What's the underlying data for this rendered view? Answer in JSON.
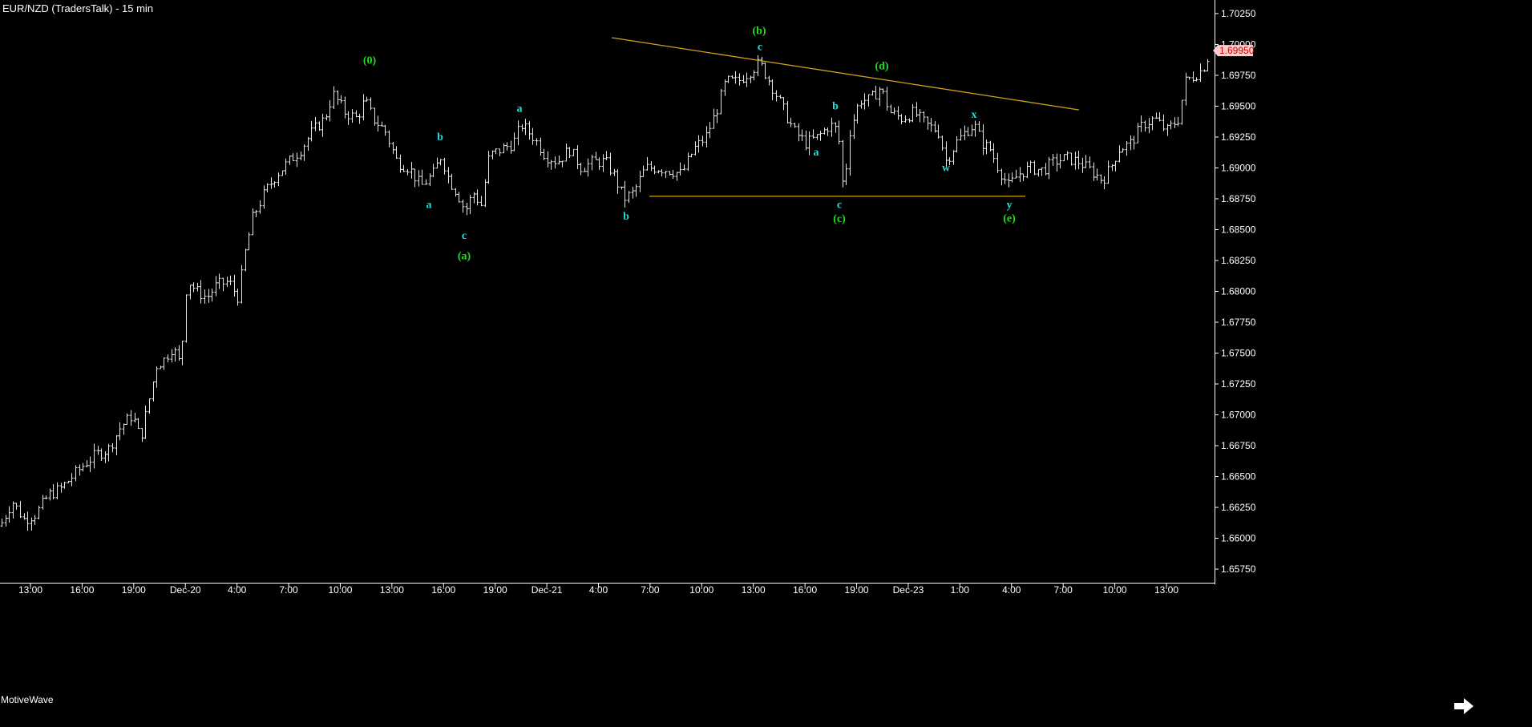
{
  "header": {
    "title": "EUR/NZD (TradersTalk) - 15 min"
  },
  "footer": {
    "brand": "MotiveWave"
  },
  "colors": {
    "background": "#000000",
    "bars": "#e6e6e6",
    "trendline": "#d4a017",
    "wave_major": "#22dd22",
    "wave_minor": "#22dddd",
    "price_badge_bg": "#ffcccc",
    "price_badge_text": "#cc0000"
  },
  "chart_data": {
    "type": "ohlc",
    "instrument": "EUR/NZD",
    "timeframe": "15 min",
    "x_tick_labels": [
      "13:00",
      "16:00",
      "19:00",
      "Dec-20",
      "4:00",
      "7:00",
      "10:00",
      "13:00",
      "16:00",
      "19:00",
      "Dec-21",
      "4:00",
      "7:00",
      "10:00",
      "13:00",
      "16:00",
      "19:00",
      "Dec-23",
      "1:00",
      "4:00",
      "7:00",
      "10:00",
      "13:00"
    ],
    "ylim": [
      1.6564,
      1.7036
    ],
    "y_ticks": [
      1.7025,
      1.7,
      1.6975,
      1.695,
      1.6925,
      1.69,
      1.6875,
      1.685,
      1.6825,
      1.68,
      1.6775,
      1.675,
      1.6725,
      1.67,
      1.6675,
      1.665,
      1.6625,
      1.66,
      1.6575
    ],
    "y_tick_labels": [
      "1.70250",
      "1.70000",
      "1.69750",
      "1.69500",
      "1.69250",
      "1.69000",
      "1.68750",
      "1.68500",
      "1.68250",
      "1.68000",
      "1.67750",
      "1.67500",
      "1.67250",
      "1.67000",
      "1.66750",
      "1.66500",
      "1.66250",
      "1.66000",
      "1.65750"
    ],
    "last_price": "1.69950",
    "price_path": [
      [
        0,
        1.661
      ],
      [
        15,
        1.663
      ],
      [
        30,
        1.6615
      ],
      [
        45,
        1.662
      ],
      [
        60,
        1.6635
      ],
      [
        75,
        1.664
      ],
      [
        90,
        1.665
      ],
      [
        105,
        1.666
      ],
      [
        120,
        1.6668
      ],
      [
        135,
        1.6672
      ],
      [
        150,
        1.669
      ],
      [
        165,
        1.67
      ],
      [
        175,
        1.668
      ],
      [
        185,
        1.671
      ],
      [
        195,
        1.674
      ],
      [
        205,
        1.6745
      ],
      [
        215,
        1.6755
      ],
      [
        225,
        1.674
      ],
      [
        233,
        1.681
      ],
      [
        245,
        1.68
      ],
      [
        258,
        1.6795
      ],
      [
        270,
        1.6805
      ],
      [
        285,
        1.6808
      ],
      [
        297,
        1.6795
      ],
      [
        305,
        1.683
      ],
      [
        315,
        1.686
      ],
      [
        330,
        1.688
      ],
      [
        345,
        1.6895
      ],
      [
        360,
        1.6905
      ],
      [
        375,
        1.6915
      ],
      [
        390,
        1.693
      ],
      [
        405,
        1.694
      ],
      [
        415,
        1.696
      ],
      [
        430,
        1.6945
      ],
      [
        445,
        1.694
      ],
      [
        455,
        1.6955
      ],
      [
        465,
        1.694
      ],
      [
        480,
        1.693
      ],
      [
        495,
        1.6905
      ],
      [
        510,
        1.69
      ],
      [
        525,
        1.6885
      ],
      [
        540,
        1.6895
      ],
      [
        550,
        1.691
      ],
      [
        560,
        1.689
      ],
      [
        570,
        1.688
      ],
      [
        580,
        1.6865
      ],
      [
        590,
        1.688
      ],
      [
        600,
        1.687
      ],
      [
        610,
        1.691
      ],
      [
        625,
        1.6915
      ],
      [
        640,
        1.692
      ],
      [
        650,
        1.6935
      ],
      [
        665,
        1.6925
      ],
      [
        680,
        1.691
      ],
      [
        695,
        1.6905
      ],
      [
        710,
        1.6915
      ],
      [
        725,
        1.69
      ],
      [
        740,
        1.6905
      ],
      [
        755,
        1.6905
      ],
      [
        765,
        1.6895
      ],
      [
        778,
        1.6875
      ],
      [
        790,
        1.688
      ],
      [
        805,
        1.69
      ],
      [
        820,
        1.69
      ],
      [
        835,
        1.6898
      ],
      [
        850,
        1.6895
      ],
      [
        865,
        1.6915
      ],
      [
        880,
        1.6925
      ],
      [
        893,
        1.6945
      ],
      [
        905,
        1.697
      ],
      [
        920,
        1.697
      ],
      [
        935,
        1.6978
      ],
      [
        947,
        1.6985
      ],
      [
        960,
        1.697
      ],
      [
        975,
        1.695
      ],
      [
        990,
        1.693
      ],
      [
        1005,
        1.692
      ],
      [
        1020,
        1.6925
      ],
      [
        1035,
        1.6935
      ],
      [
        1045,
        1.693
      ],
      [
        1052,
        1.688
      ],
      [
        1060,
        1.693
      ],
      [
        1072,
        1.6955
      ],
      [
        1085,
        1.6955
      ],
      [
        1098,
        1.6965
      ],
      [
        1110,
        1.6945
      ],
      [
        1125,
        1.694
      ],
      [
        1140,
        1.6945
      ],
      [
        1155,
        1.6935
      ],
      [
        1170,
        1.693
      ],
      [
        1180,
        1.6905
      ],
      [
        1192,
        1.692
      ],
      [
        1205,
        1.693
      ],
      [
        1215,
        1.6935
      ],
      [
        1225,
        1.692
      ],
      [
        1235,
        1.6915
      ],
      [
        1245,
        1.69
      ],
      [
        1258,
        1.6885
      ],
      [
        1270,
        1.6895
      ],
      [
        1285,
        1.69
      ],
      [
        1300,
        1.6898
      ],
      [
        1315,
        1.6905
      ],
      [
        1330,
        1.6908
      ],
      [
        1345,
        1.6905
      ],
      [
        1360,
        1.6898
      ],
      [
        1375,
        1.689
      ],
      [
        1385,
        1.69
      ],
      [
        1395,
        1.6915
      ],
      [
        1410,
        1.692
      ],
      [
        1425,
        1.6935
      ],
      [
        1440,
        1.694
      ],
      [
        1455,
        1.693
      ],
      [
        1470,
        1.694
      ],
      [
        1478,
        1.697
      ],
      [
        1490,
        1.6975
      ],
      [
        1500,
        1.698
      ],
      [
        1510,
        1.6995
      ]
    ],
    "trendlines": [
      {
        "name": "upper",
        "x1": 763,
        "y1": 1.70055,
        "x2": 1346,
        "y2": 1.6947
      },
      {
        "name": "lower",
        "x1": 810,
        "y1": 1.6877,
        "x2": 1279,
        "y2": 1.6877
      }
    ],
    "wave_labels": [
      {
        "text": "(0)",
        "x": 461,
        "y": 1.69845,
        "color": "wave_major"
      },
      {
        "text": "b",
        "x": 549,
        "y": 1.69225,
        "color": "wave_minor"
      },
      {
        "text": "a",
        "x": 535,
        "y": 1.68675,
        "color": "wave_minor"
      },
      {
        "text": "c",
        "x": 579,
        "y": 1.68425,
        "color": "wave_minor"
      },
      {
        "text": "(a)",
        "x": 579,
        "y": 1.6826,
        "color": "wave_major"
      },
      {
        "text": "a",
        "x": 648,
        "y": 1.69455,
        "color": "wave_minor"
      },
      {
        "text": "b",
        "x": 781,
        "y": 1.6858,
        "color": "wave_minor"
      },
      {
        "text": "(b)",
        "x": 947,
        "y": 1.70085,
        "color": "wave_major"
      },
      {
        "text": "c",
        "x": 948,
        "y": 1.69955,
        "color": "wave_minor"
      },
      {
        "text": "b",
        "x": 1042,
        "y": 1.69475,
        "color": "wave_minor"
      },
      {
        "text": "a",
        "x": 1018,
        "y": 1.691,
        "color": "wave_minor"
      },
      {
        "text": "c",
        "x": 1047,
        "y": 1.68675,
        "color": "wave_minor"
      },
      {
        "text": "(c)",
        "x": 1047,
        "y": 1.6856,
        "color": "wave_major"
      },
      {
        "text": "(d)",
        "x": 1100,
        "y": 1.698,
        "color": "wave_major"
      },
      {
        "text": "w",
        "x": 1180,
        "y": 1.68975,
        "color": "wave_minor"
      },
      {
        "text": "x",
        "x": 1215,
        "y": 1.69405,
        "color": "wave_minor"
      },
      {
        "text": "y",
        "x": 1259,
        "y": 1.68675,
        "color": "wave_minor"
      },
      {
        "text": "(e)",
        "x": 1259,
        "y": 1.68565,
        "color": "wave_major"
      }
    ]
  }
}
